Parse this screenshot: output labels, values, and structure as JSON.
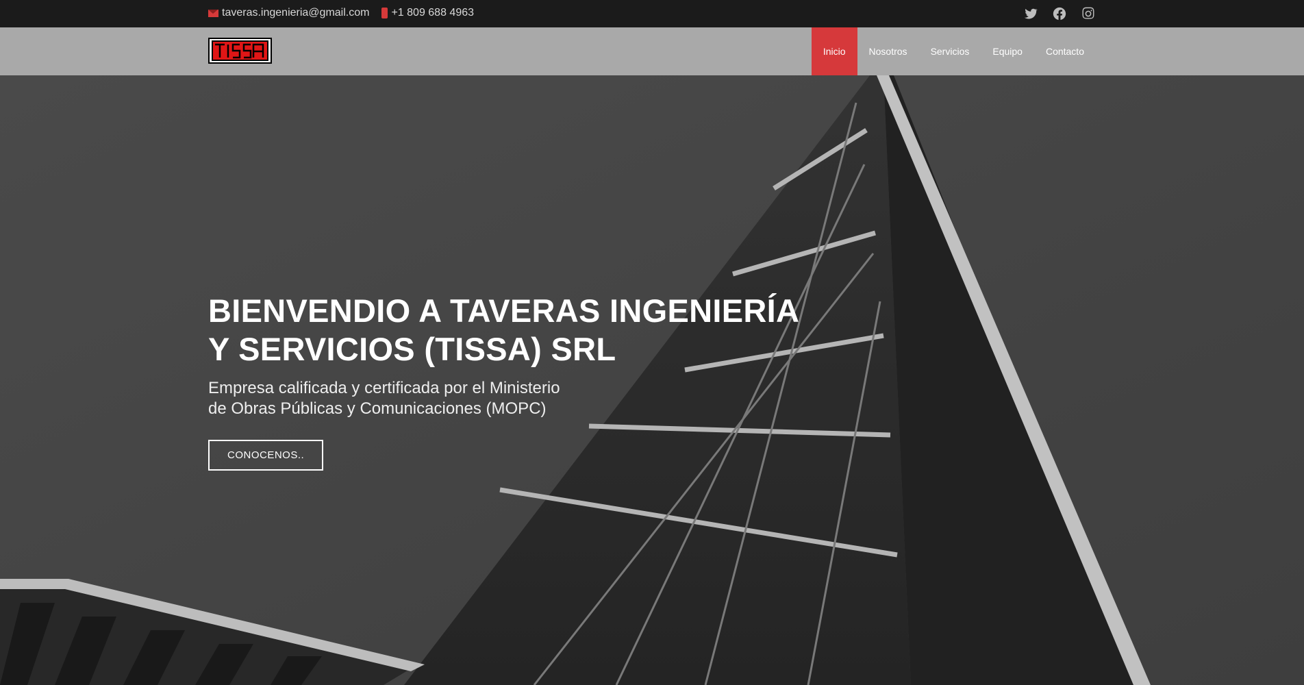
{
  "topbar": {
    "email": "taveras.ingenieria@gmail.com",
    "phone": "+1 809 688 4963",
    "social": [
      "twitter-icon",
      "facebook-icon",
      "instagram-icon"
    ]
  },
  "header": {
    "logo_text": "TISSA",
    "nav": [
      {
        "label": "Inicio",
        "active": true
      },
      {
        "label": "Nosotros",
        "active": false
      },
      {
        "label": "Servicios",
        "active": false
      },
      {
        "label": "Equipo",
        "active": false
      },
      {
        "label": "Contacto",
        "active": false
      }
    ]
  },
  "hero": {
    "title_line1": "BIENVENDIO A TAVERAS INGENIERÍA",
    "title_line2": "Y SERVICIOS (TISSA) SRL",
    "subtitle_line1": "Empresa calificada y certificada por el Ministerio",
    "subtitle_line2": "de Obras Públicas y Comunicaciones (MOPC)",
    "button_label": "CONOCENOS.."
  },
  "colors": {
    "accent": "#d6393b",
    "topbar_bg": "#1b1b1b",
    "header_bg": "#a9a9a9"
  }
}
